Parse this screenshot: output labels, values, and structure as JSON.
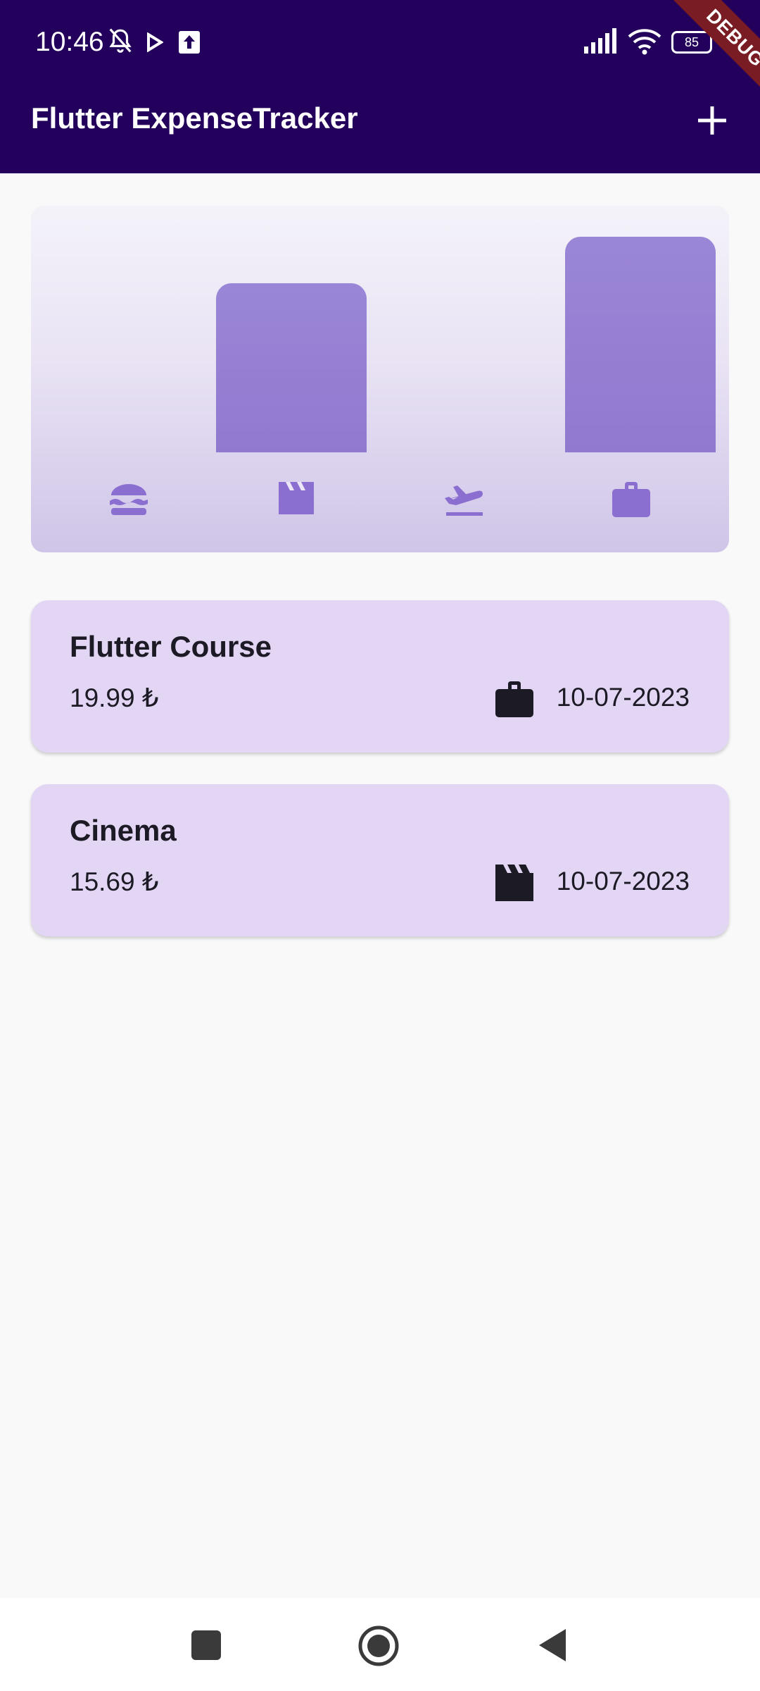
{
  "status_bar": {
    "time": "10:46",
    "battery": "85",
    "icons": [
      "bell-off-icon",
      "play-icon",
      "upload-icon",
      "signal-icon",
      "wifi-icon",
      "battery-icon"
    ]
  },
  "app_bar": {
    "title": "Flutter ExpenseTracker",
    "add_icon": "plus-icon",
    "debug_label": "DEBUG"
  },
  "chart_data": {
    "type": "bar",
    "categories": [
      "food",
      "leisure",
      "travel",
      "work"
    ],
    "category_icons": [
      "burger-icon",
      "clapperboard-icon",
      "flight-takeoff-icon",
      "briefcase-icon"
    ],
    "values": [
      0,
      15.69,
      0,
      19.99
    ],
    "colors": {
      "bar": "#9580d3",
      "icon": "#8b6fd0"
    }
  },
  "expenses": [
    {
      "title": "Flutter Course",
      "amount": "19.99 ₺",
      "category_icon": "briefcase-icon",
      "date": "10-07-2023"
    },
    {
      "title": "Cinema",
      "amount": "15.69 ₺",
      "category_icon": "clapperboard-icon",
      "date": "10-07-2023"
    }
  ],
  "nav_bar": {
    "buttons": [
      "recents-square-icon",
      "home-circle-icon",
      "back-triangle-icon"
    ]
  },
  "colors": {
    "app_bar": "#23005b",
    "card": "#e2d6f4",
    "accent": "#8b6fd0",
    "debug_ribbon": "#7a1c23"
  }
}
